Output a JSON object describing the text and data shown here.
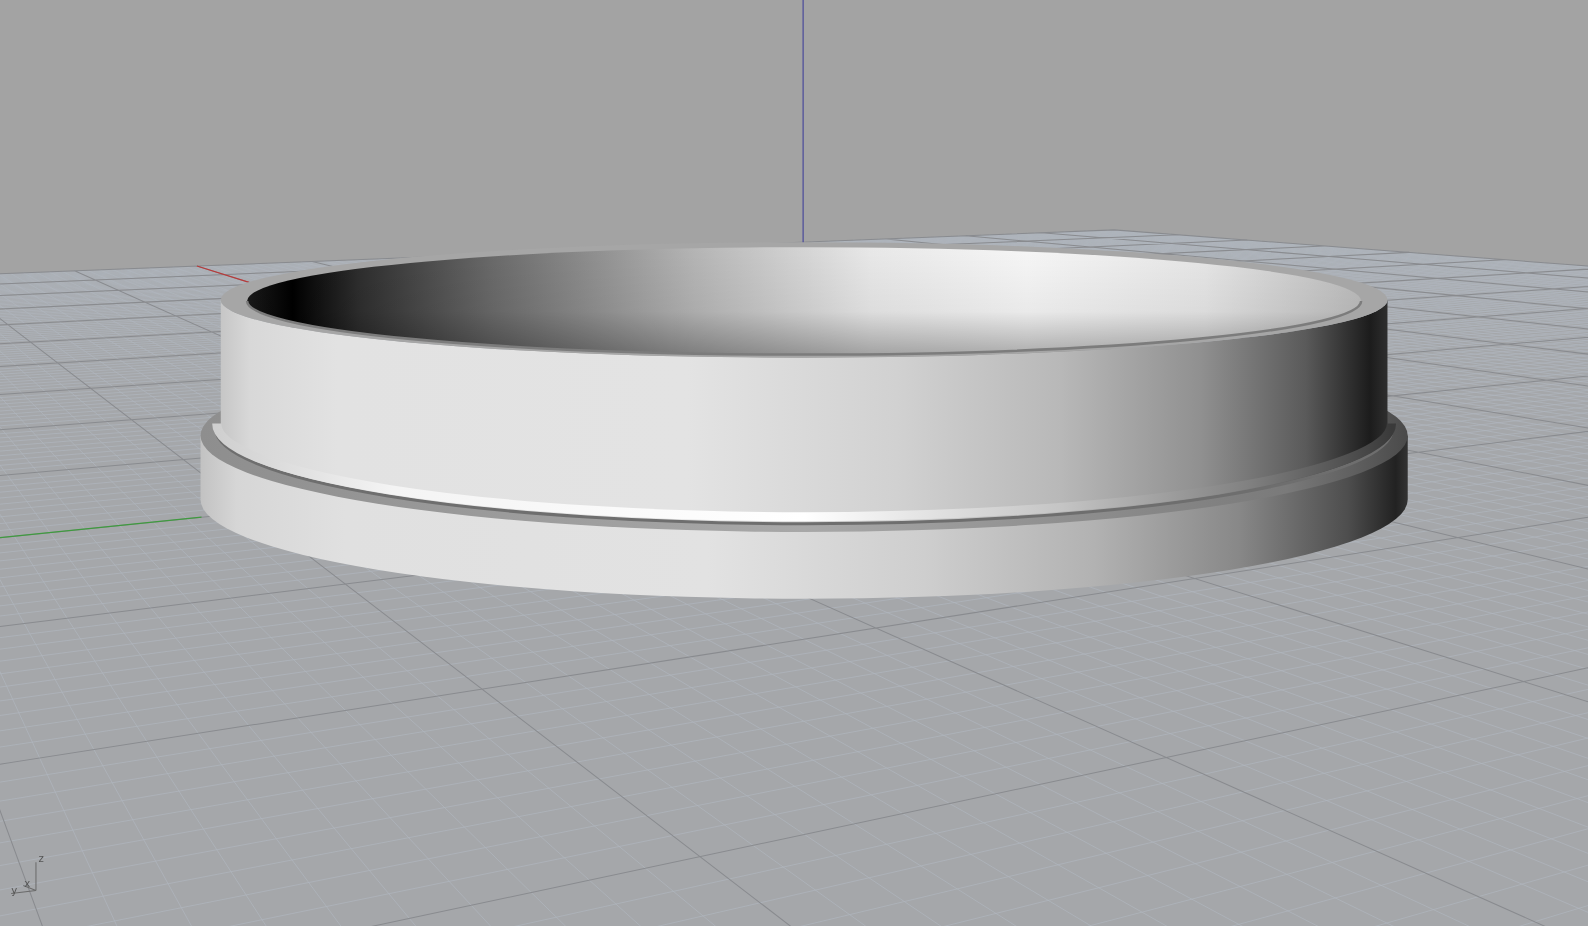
{
  "viewport": {
    "axis_triad": {
      "labels": [
        "z",
        "x",
        "y"
      ]
    }
  }
}
